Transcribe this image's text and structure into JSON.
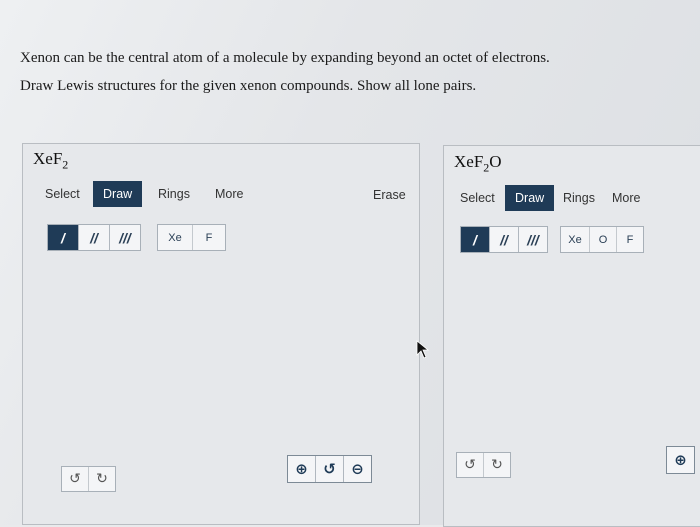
{
  "instructions": {
    "line1": "Xenon can be the central atom of a molecule by expanding beyond an octet of electrons.",
    "line2": "Draw Lewis structures for the given xenon compounds. Show all lone pairs."
  },
  "panels": [
    {
      "formula_main": "XeF",
      "formula_sub": "2",
      "formula_tail": "",
      "toolbar": {
        "select": "Select",
        "draw": "Draw",
        "rings": "Rings",
        "more": "More",
        "erase": "Erase"
      },
      "atoms": [
        "Xe",
        "F"
      ]
    },
    {
      "formula_main": "XeF",
      "formula_sub": "2",
      "formula_tail": "O",
      "toolbar": {
        "select": "Select",
        "draw": "Draw",
        "rings": "Rings",
        "more": "More"
      },
      "atoms": [
        "Xe",
        "O",
        "F"
      ]
    }
  ],
  "bonds": [
    "/",
    "//",
    "///"
  ],
  "icons": {
    "undo": "undo-icon",
    "redo": "redo-icon",
    "zoom_in": "zoom-in-icon",
    "reset": "reset-zoom-icon",
    "zoom_out": "zoom-out-icon"
  },
  "colors": {
    "accent": "#1f3b57",
    "background": "#e6e8eb"
  }
}
